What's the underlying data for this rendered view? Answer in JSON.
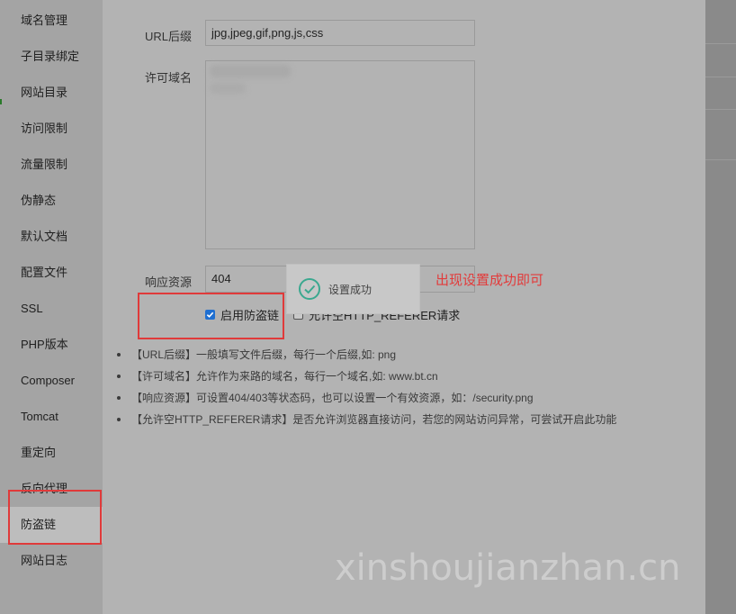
{
  "sidebar": {
    "items": [
      {
        "label": "域名管理"
      },
      {
        "label": "子目录绑定"
      },
      {
        "label": "网站目录"
      },
      {
        "label": "访问限制"
      },
      {
        "label": "流量限制"
      },
      {
        "label": "伪静态"
      },
      {
        "label": "默认文档"
      },
      {
        "label": "配置文件"
      },
      {
        "label": "SSL"
      },
      {
        "label": "PHP版本"
      },
      {
        "label": "Composer"
      },
      {
        "label": "Tomcat"
      },
      {
        "label": "重定向"
      },
      {
        "label": "反向代理"
      },
      {
        "label": "防盗链"
      },
      {
        "label": "网站日志"
      }
    ],
    "active_item": "防盗链"
  },
  "form": {
    "url_suffix_label": "URL后缀",
    "url_suffix_value": "jpg,jpeg,gif,png,js,css",
    "allowed_domains_label": "许可域名",
    "response_label": "响应资源",
    "response_value": "404",
    "enable_label": "启用防盗链",
    "enable_checked": true,
    "allow_empty_label": "允许空HTTP_REFERER请求",
    "allow_empty_checked": false
  },
  "notes": [
    "【URL后缀】一般填写文件后缀，每行一个后缀,如: png",
    "【许可域名】允许作为来路的域名，每行一个域名,如: www.bt.cn",
    "【响应资源】可设置404/403等状态码，也可以设置一个有效资源，如：/security.png",
    "【允许空HTTP_REFERER请求】是否允许浏览器直接访问，若您的网站访问异常，可尝试开启此功能"
  ],
  "toast": {
    "text": "设置成功",
    "icon": "check-circle-icon"
  },
  "annotation": {
    "text": "出现设置成功即可",
    "color": "#e23b3b"
  },
  "watermark": "xinshoujianzhan.cn",
  "colors": {
    "checkbox_checked": "#1f6fd1",
    "toast_icon": "#3aa88f"
  }
}
